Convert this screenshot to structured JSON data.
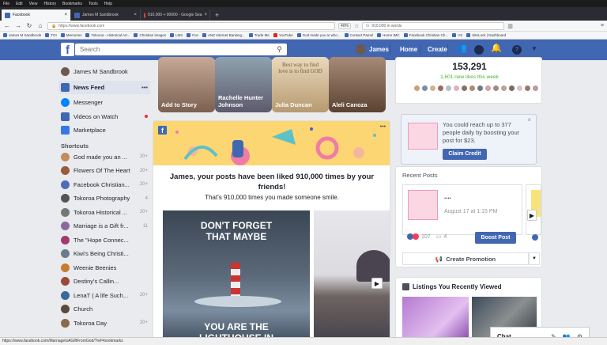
{
  "browser": {
    "menus": [
      "File",
      "Edit",
      "View",
      "History",
      "Bookmarks",
      "Tools",
      "Help"
    ],
    "tabs": [
      {
        "label": "Facebook",
        "active": true
      },
      {
        "label": "James M Sandbrook",
        "active": false
      },
      {
        "label": "910,000 + 00000 - Google Sea",
        "active": false
      }
    ],
    "url": "https://www.facebook.com",
    "zoom": "40%",
    "search_text": "910,000 in words",
    "bookmarks": [
      "James M Sandbrook",
      "TOI",
      "Memories",
      "Tokoroa - Historical Art...",
      "Christian images",
      "LMS",
      "Fun",
      "ANZ Internet Banking...",
      "Trade Me",
      "YouTube",
      "God made you ar who...",
      "Contact Pamel",
      "Home IMC",
      "Facebook Christian Ch...",
      "VS",
      "SiteLock | Dashboard"
    ],
    "status": "https://www.facebook.com/MarriageIsAGiftFromGod/?ref=bookmarks"
  },
  "fb": {
    "logo": "f",
    "search_placeholder": "Search",
    "user_name": "James",
    "home": "Home",
    "create": "Create",
    "sidebar_user": "James M Sandbrook",
    "sidebar_items": [
      {
        "label": "News Feed",
        "color": "#4267b2"
      },
      {
        "label": "Messenger",
        "color": "#0084ff"
      },
      {
        "label": "Videos on Watch",
        "color": "#4267b2"
      },
      {
        "label": "Marketplace",
        "color": "#3578e5"
      }
    ],
    "shortcuts_title": "Shortcuts",
    "shortcuts": [
      {
        "label": "God made you an ...",
        "count": "20+",
        "color": "#c48b5f"
      },
      {
        "label": "Flowers Of The Heart",
        "count": "20+",
        "color": "#9a5a3d"
      },
      {
        "label": "Facebook Christian...",
        "count": "20+",
        "color": "#4f6cb8"
      },
      {
        "label": "Tokoroa Photography",
        "count": "4",
        "color": "#555"
      },
      {
        "label": "Tokoroa Historical ...",
        "count": "20+",
        "color": "#777"
      },
      {
        "label": "Marriage is a Gift fr...",
        "count": "11",
        "color": "#8b6a9c"
      },
      {
        "label": "The \"Hope Connec...",
        "count": "",
        "color": "#a23a6a"
      },
      {
        "label": "Kiwi's Being Christi...",
        "count": "",
        "color": "#6b7b8b"
      },
      {
        "label": "Weenie Beenies",
        "count": "",
        "color": "#c77d2f"
      },
      {
        "label": "Destiny's Callin...",
        "count": "",
        "color": "#9b4a3a"
      },
      {
        "label": "LenaT ( A life Such...",
        "count": "20+",
        "color": "#3a6a9b"
      },
      {
        "label": "Church",
        "count": "",
        "color": "#5a4a3a"
      },
      {
        "label": "Tokoroa Day",
        "count": "20+",
        "color": "#8a6a4a"
      }
    ],
    "stories": [
      {
        "label": "Add to Story",
        "bg": "#b89a86"
      },
      {
        "label": "Rachelle Hunter Johnson",
        "bg": "#7c8b97"
      },
      {
        "label": "Julia Duncan",
        "bg": "#c7b89a"
      },
      {
        "label": "Aleli Canoza",
        "bg": "#9a7a68"
      }
    ],
    "story_quote": "Best way to find love is to find GOD",
    "memory": {
      "title": "James, your posts have been liked 910,000 times by your friends!",
      "subtitle": "That's 910,000 times you made someone smile.",
      "image_line1": "DON'T FORGET",
      "image_line2": "THAT MAYBE",
      "image_line3": "YOU ARE THE",
      "image_line4": "LIGHTHOUSE IN"
    },
    "page_stats": {
      "likes": "153,291",
      "new_likes": "1,601 new likes this week"
    },
    "boost_promo": {
      "text": "You could reach up to 377 people daily by boosting your post for $23.",
      "button": "Claim Credit"
    },
    "recent_posts": {
      "title": "Recent Posts",
      "post_title": "....",
      "post_date": "August 17 at 1:15 PM",
      "reactions": "107",
      "comments": "4",
      "boost_button": "Boost Post",
      "create_promotion": "Create Promotion"
    },
    "listings_title": "Listings You Recently Viewed",
    "chat_label": "Chat"
  }
}
